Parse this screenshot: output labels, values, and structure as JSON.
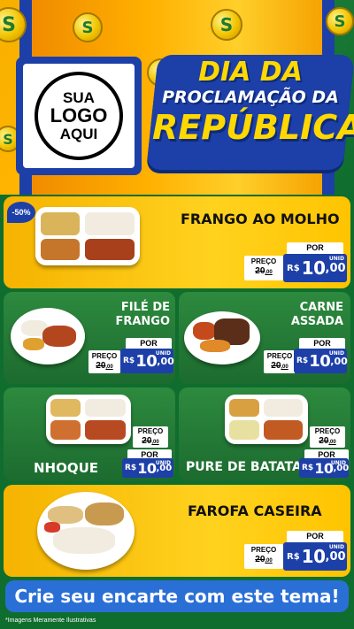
{
  "header": {
    "logo": {
      "line1": "SUA",
      "line2": "LOGO",
      "line3": "AQUI"
    },
    "title": {
      "line1": "DIA DA",
      "line2": "PROCLAMAÇÃO DA",
      "line3": "REPÚBLICA"
    },
    "coin_symbol": "S"
  },
  "discount_badge": "-50%",
  "products": [
    {
      "name": "FRANGO AO MOLHO",
      "preco_label": "PREÇO",
      "old_price": "20",
      "old_cents": ",00",
      "por_label": "POR",
      "currency": "R$",
      "price": "10",
      "cents": ",00",
      "unit": "UNID"
    },
    {
      "name_line1": "FILÉ DE",
      "name_line2": "FRANGO",
      "preco_label": "PREÇO",
      "old_price": "20",
      "old_cents": ",00",
      "por_label": "POR",
      "currency": "R$",
      "price": "10",
      "cents": ",00",
      "unit": "UNID"
    },
    {
      "name_line1": "CARNE",
      "name_line2": "ASSADA",
      "preco_label": "PREÇO",
      "old_price": "20",
      "old_cents": ",00",
      "por_label": "POR",
      "currency": "R$",
      "price": "10",
      "cents": ",00",
      "unit": "UNID"
    },
    {
      "name": "NHOQUE",
      "preco_label": "PREÇO",
      "old_price": "20",
      "old_cents": ",00",
      "por_label": "POR",
      "currency": "R$",
      "price": "10",
      "cents": ",00",
      "unit": "UNID"
    },
    {
      "name": "PURE DE BATATA",
      "preco_label": "PREÇO",
      "old_price": "20",
      "old_cents": ",00",
      "por_label": "POR",
      "currency": "R$",
      "price": "10",
      "cents": ",00",
      "unit": "UNID"
    },
    {
      "name": "FAROFA CASEIRA",
      "preco_label": "PREÇO",
      "old_price": "20",
      "old_cents": ",00",
      "por_label": "POR",
      "currency": "R$",
      "price": "10",
      "cents": ",00",
      "unit": "UNID"
    }
  ],
  "cta": "Crie seu encarte com este tema!",
  "disclaimer": "*Imagens Meramente Ilustrativas",
  "colors": {
    "accent_blue": "#1d3fa8",
    "yellow": "#ffc400",
    "green": "#1c6b2f",
    "cta_blue": "#2a6fd6"
  }
}
